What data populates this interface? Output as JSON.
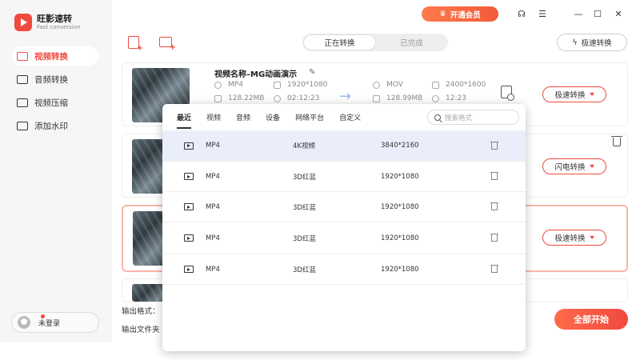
{
  "app": {
    "name": "旺影速转",
    "subtitle": "Fast conversion"
  },
  "sidebar": {
    "items": [
      {
        "label": "视频转换",
        "active": true,
        "icon": "video-convert-icon"
      },
      {
        "label": "音频转换",
        "active": false,
        "icon": "audio-convert-icon"
      },
      {
        "label": "视频压缩",
        "active": false,
        "icon": "video-compress-icon"
      },
      {
        "label": "添加水印",
        "active": false,
        "icon": "watermark-icon"
      }
    ],
    "user": {
      "label": "未登录"
    }
  },
  "header": {
    "vip_label": "开通会员",
    "fast_label": "极速转换"
  },
  "tabs": [
    {
      "label": "正在转换",
      "active": true
    },
    {
      "label": "已完成",
      "active": false
    }
  ],
  "file": {
    "title": "视频名称–MG动画演示",
    "source": {
      "format": "MP4",
      "resolution": "1920*1080",
      "size": "128.22MB",
      "duration": "02:12:23"
    },
    "target": {
      "format": "MOV",
      "resolution": "2400*1600",
      "size": "128.99MB",
      "duration": "12:23"
    }
  },
  "cards": [
    {
      "button": "极速转换"
    },
    {
      "button": "闪电转换"
    },
    {
      "button": "极速转换"
    }
  ],
  "bottom": {
    "output_format": "输出格式：",
    "output_folder": "输出文件夹",
    "start_label": "全部开始"
  },
  "popup": {
    "tabs": [
      "最近",
      "视频",
      "音频",
      "设备",
      "网络平台",
      "自定义"
    ],
    "active_tab": "最近",
    "search_placeholder": "搜索格式",
    "rows": [
      {
        "format": "MP4",
        "quality": "4K视频",
        "resolution": "3840*2160",
        "selected": true
      },
      {
        "format": "MP4",
        "quality": "3D红蓝",
        "resolution": "1920*1080",
        "selected": false
      },
      {
        "format": "MP4",
        "quality": "3D红蓝",
        "resolution": "1920*1080",
        "selected": false
      },
      {
        "format": "MP4",
        "quality": "3D红蓝",
        "resolution": "1920*1080",
        "selected": false
      },
      {
        "format": "MP4",
        "quality": "3D红蓝",
        "resolution": "1920*1080",
        "selected": false
      }
    ]
  },
  "colors": {
    "accent": "#f04a3e",
    "selected_row": "#e9eefa",
    "sidebar_bg": "#f6f6f6"
  }
}
